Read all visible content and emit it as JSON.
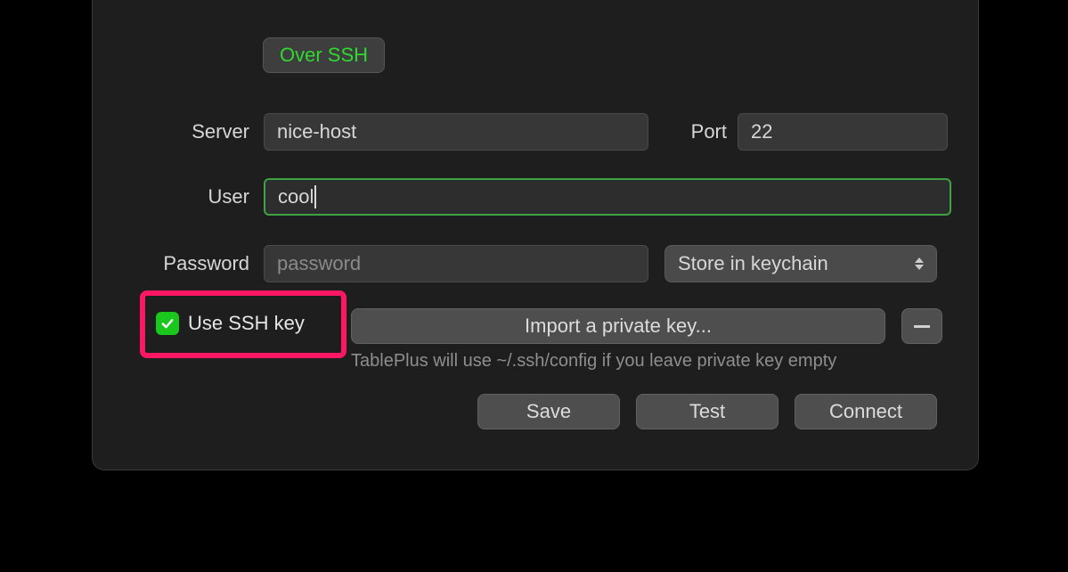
{
  "tab": {
    "label": "Over SSH"
  },
  "server": {
    "label": "Server",
    "value": "nice-host"
  },
  "port": {
    "label": "Port",
    "value": "22"
  },
  "user": {
    "label": "User",
    "value": "cool"
  },
  "password": {
    "label": "Password",
    "placeholder": "password",
    "store_option": "Store in keychain"
  },
  "ssh_key": {
    "checkbox_label": "Use SSH key",
    "checked": true,
    "import_button": "Import a private key...",
    "hint": "TablePlus will use ~/.ssh/config if you leave private key empty"
  },
  "actions": {
    "save": "Save",
    "test": "Test",
    "connect": "Connect"
  }
}
